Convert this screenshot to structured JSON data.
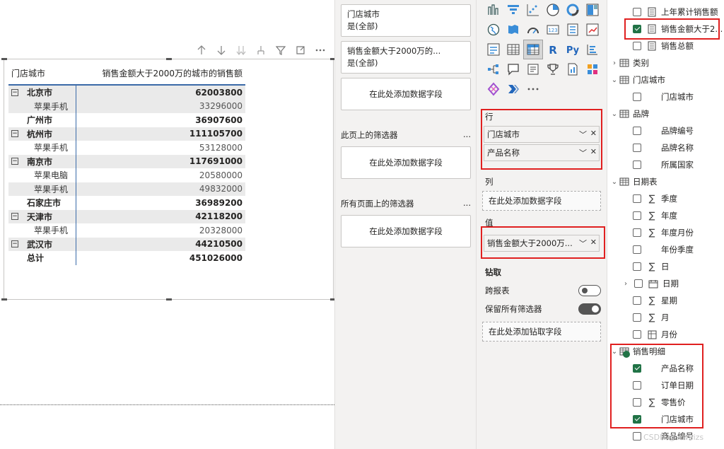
{
  "matrix": {
    "header": {
      "col1": "门店城市",
      "col2": "销售金额大于2000万的城市的销售额"
    },
    "rows": [
      {
        "type": "city",
        "label": "北京市",
        "value": "62003800",
        "shade": true,
        "expander": "−"
      },
      {
        "type": "child",
        "label": "苹果手机",
        "value": "33296000",
        "shade": true
      },
      {
        "type": "city",
        "label": "广州市",
        "value": "36907600",
        "shade": false
      },
      {
        "type": "city",
        "label": "杭州市",
        "value": "111105700",
        "shade": true,
        "expander": "−"
      },
      {
        "type": "child",
        "label": "苹果手机",
        "value": "53128000",
        "shade": false
      },
      {
        "type": "city",
        "label": "南京市",
        "value": "117691000",
        "shade": true,
        "expander": "−"
      },
      {
        "type": "child",
        "label": "苹果电脑",
        "value": "20580000",
        "shade": false
      },
      {
        "type": "child",
        "label": "苹果手机",
        "value": "49832000",
        "shade": true
      },
      {
        "type": "city",
        "label": "石家庄市",
        "value": "36989200",
        "shade": false
      },
      {
        "type": "city",
        "label": "天津市",
        "value": "42118200",
        "shade": true,
        "expander": "−"
      },
      {
        "type": "child",
        "label": "苹果手机",
        "value": "20328000",
        "shade": false
      },
      {
        "type": "city",
        "label": "武汉市",
        "value": "44210500",
        "shade": true,
        "expander": "−"
      },
      {
        "type": "total",
        "label": "总计",
        "value": "451026000",
        "shade": false
      }
    ]
  },
  "filters": {
    "card1": {
      "title": "门店城市",
      "value": "是(全部)"
    },
    "card2": {
      "title": "销售金额大于2000万的...",
      "value": "是(全部)"
    },
    "add_field": "在此处添加数据字段",
    "page_filters": "此页上的筛选器",
    "all_pages_filters": "所有页面上的筛选器",
    "more": "..."
  },
  "viz": {
    "rows_label": "行",
    "row_fields": [
      "门店城市",
      "产品名称"
    ],
    "columns_label": "列",
    "values_label": "值",
    "value_fields": [
      "销售金额大于2000万..."
    ],
    "add_field": "在此处添加数据字段",
    "drill_label": "钻取",
    "cross_report": "跨报表",
    "keep_filters": "保留所有筛选器",
    "add_drill_field": "在此处添加钻取字段"
  },
  "fields": {
    "items": [
      {
        "label": "上年累计销售额",
        "kind": "measure",
        "checked": false,
        "indent": 2
      },
      {
        "label": "销售金额大于2...",
        "kind": "measure",
        "checked": true,
        "indent": 2
      },
      {
        "label": "销售总额",
        "kind": "measure",
        "checked": false,
        "indent": 2
      },
      {
        "label": "类别",
        "kind": "table",
        "indent": 0,
        "chevron": ">"
      },
      {
        "label": "门店城市",
        "kind": "table",
        "indent": 0,
        "chevron": "v"
      },
      {
        "label": "门店城市",
        "kind": "field",
        "checked": false,
        "indent": 2
      },
      {
        "label": "品牌",
        "kind": "table",
        "indent": 0,
        "chevron": "v"
      },
      {
        "label": "品牌编号",
        "kind": "field",
        "checked": false,
        "indent": 2
      },
      {
        "label": "品牌名称",
        "kind": "field",
        "checked": false,
        "indent": 2
      },
      {
        "label": "所属国家",
        "kind": "field",
        "checked": false,
        "indent": 2
      },
      {
        "label": "日期表",
        "kind": "table",
        "indent": 0,
        "chevron": "v"
      },
      {
        "label": "季度",
        "kind": "sigma",
        "checked": false,
        "indent": 2
      },
      {
        "label": "年度",
        "kind": "sigma",
        "checked": false,
        "indent": 2
      },
      {
        "label": "年度月份",
        "kind": "sigma",
        "checked": false,
        "indent": 2
      },
      {
        "label": "年份季度",
        "kind": "field",
        "checked": false,
        "indent": 2
      },
      {
        "label": "日",
        "kind": "sigma",
        "checked": false,
        "indent": 2
      },
      {
        "label": "日期",
        "kind": "date",
        "checked": false,
        "indent": 1,
        "chevron": ">"
      },
      {
        "label": "星期",
        "kind": "sigma",
        "checked": false,
        "indent": 2
      },
      {
        "label": "月",
        "kind": "sigma",
        "checked": false,
        "indent": 2
      },
      {
        "label": "月份",
        "kind": "calc",
        "checked": false,
        "indent": 2
      },
      {
        "label": "销售明细",
        "kind": "table-checked",
        "indent": 0,
        "chevron": "v"
      },
      {
        "label": "产品名称",
        "kind": "field",
        "checked": true,
        "indent": 2
      },
      {
        "label": "订单日期",
        "kind": "field",
        "checked": false,
        "indent": 2
      },
      {
        "label": "零售价",
        "kind": "sigma",
        "checked": false,
        "indent": 2
      },
      {
        "label": "门店城市",
        "kind": "field",
        "checked": true,
        "indent": 2
      },
      {
        "label": "商品编号",
        "kind": "field",
        "checked": false,
        "indent": 2
      }
    ],
    "watermark": "CSDN @wwaizs"
  },
  "colors": {
    "accent": "#3a6aa8",
    "highlight": "#e02020",
    "check": "#217346"
  }
}
